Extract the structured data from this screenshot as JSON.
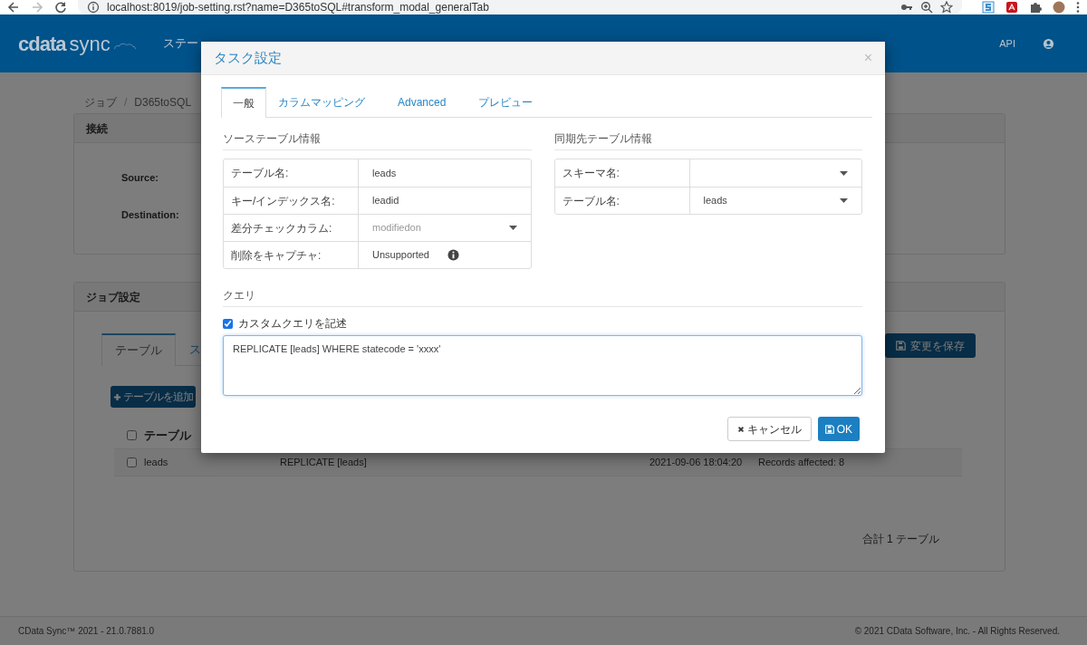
{
  "browser": {
    "url": "localhost:8019/job-setting.rst?name=D365toSQL#transform_modal_generalTab"
  },
  "navbar": {
    "logo": {
      "brand": "cdata",
      "product": "sync"
    },
    "items": [
      "ステー"
    ],
    "right_link": "API"
  },
  "breadcrumb": {
    "items": [
      "ジョブ",
      "D365toSQL"
    ],
    "separator": "/"
  },
  "connection_card": {
    "title": "接続",
    "fields": [
      {
        "label": "Source:"
      },
      {
        "label": "Destination:"
      }
    ]
  },
  "job_card": {
    "title": "ジョブ設定",
    "tabs": [
      {
        "label": "テーブル",
        "selected": true
      },
      {
        "label": "ス",
        "selected": false
      }
    ],
    "add_button": "テーブルを追加",
    "save_button": "変更を保存",
    "table": {
      "header_checked": false,
      "columns": [
        "テーブル"
      ],
      "rows": [
        {
          "checked": false,
          "cells": [
            "leads",
            "REPLICATE [leads]",
            "2021-09-06 18:04:20",
            "Records affected: 8"
          ]
        }
      ]
    },
    "total": "合計 1 テーブル"
  },
  "footer": {
    "left": "CData Sync™ 2021 - 21.0.7881.0",
    "right": "© 2021 CData Software, Inc. - All Rights Reserved."
  },
  "modal": {
    "title": "タスク設定",
    "close": "×",
    "tabs": [
      {
        "label": "一般",
        "selected": true
      },
      {
        "label": "カラムマッピング",
        "selected": false
      },
      {
        "label": "Advanced",
        "selected": false
      },
      {
        "label": "プレビュー",
        "selected": false
      }
    ],
    "source": {
      "title": "ソーステーブル情報",
      "rows": [
        {
          "label": "テーブル名:",
          "value": "leads",
          "kind": "text",
          "disabled": false
        },
        {
          "label": "キー/インデックス名:",
          "value": "leadid",
          "kind": "text",
          "disabled": false
        },
        {
          "label": "差分チェックカラム:",
          "value": "modifiedon",
          "kind": "select",
          "disabled": true
        },
        {
          "label": "削除をキャプチャ:",
          "value": "Unsupported",
          "kind": "info",
          "disabled": false
        }
      ]
    },
    "destination": {
      "title": "同期先テーブル情報",
      "rows": [
        {
          "label": "スキーマ名:",
          "kind": "select"
        },
        {
          "label": "テーブル名:",
          "value": "leads",
          "kind": "select"
        }
      ]
    },
    "query": {
      "title": "クエリ",
      "custom": {
        "label": "カスタムクエリを記述",
        "checked": true
      },
      "text": "REPLICATE [leads] WHERE statecode = 'xxxx'"
    },
    "buttons": [
      {
        "label": "キャンセル",
        "kind": "cancel"
      },
      {
        "label": "OK",
        "kind": "ok"
      }
    ]
  }
}
